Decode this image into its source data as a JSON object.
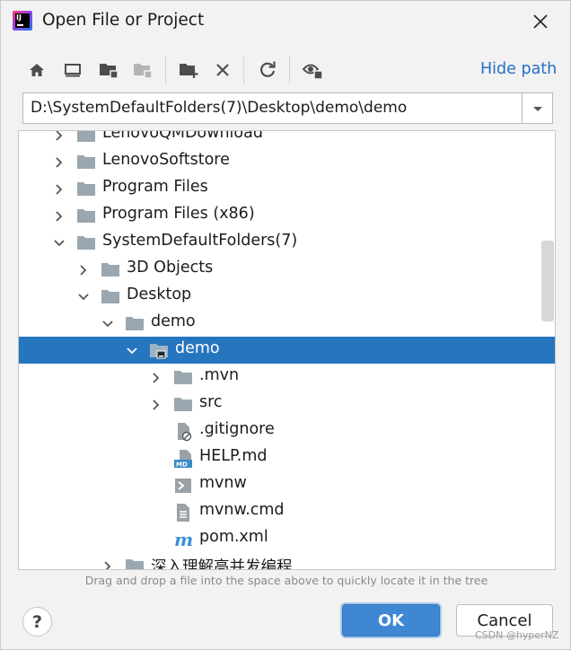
{
  "window": {
    "title": "Open File or Project",
    "app_icon_text": "IJ"
  },
  "toolbar": {
    "buttons": [
      "home-icon",
      "desktop-icon",
      "project-folder-icon",
      "module-folder-icon",
      "new-folder-icon",
      "delete-icon",
      "refresh-icon",
      "show-hidden-icon"
    ],
    "hide_path_label": "Hide path"
  },
  "path": {
    "value": "D:\\SystemDefaultFolders(7)\\Desktop\\demo\\demo"
  },
  "tree": {
    "rows": [
      {
        "label": "LenovoQMDownload",
        "expandable": true,
        "expanded": false,
        "icon": "folder-icon"
      },
      {
        "label": "LenovoSoftstore",
        "expandable": true,
        "expanded": false,
        "icon": "folder-icon"
      },
      {
        "label": "Program Files",
        "expandable": true,
        "expanded": false,
        "icon": "folder-icon"
      },
      {
        "label": "Program Files (x86)",
        "expandable": true,
        "expanded": false,
        "icon": "folder-icon"
      },
      {
        "label": "SystemDefaultFolders(7)",
        "expandable": true,
        "expanded": true,
        "icon": "folder-icon"
      },
      {
        "label": "3D Objects",
        "expandable": true,
        "expanded": false,
        "icon": "folder-icon"
      },
      {
        "label": "Desktop",
        "expandable": true,
        "expanded": true,
        "icon": "folder-icon"
      },
      {
        "label": "demo",
        "expandable": true,
        "expanded": true,
        "icon": "folder-icon"
      },
      {
        "label": "demo",
        "expandable": true,
        "expanded": true,
        "icon": "project-folder-icon",
        "selected": true
      },
      {
        "label": ".mvn",
        "expandable": true,
        "expanded": false,
        "icon": "folder-icon"
      },
      {
        "label": "src",
        "expandable": true,
        "expanded": false,
        "icon": "folder-icon"
      },
      {
        "label": ".gitignore",
        "expandable": false,
        "icon": "ignored-file-icon"
      },
      {
        "label": "HELP.md",
        "expandable": false,
        "icon": "markdown-file-icon",
        "icon_text": "MD"
      },
      {
        "label": "mvnw",
        "expandable": false,
        "icon": "shell-file-icon"
      },
      {
        "label": "mvnw.cmd",
        "expandable": false,
        "icon": "text-file-icon"
      },
      {
        "label": "pom.xml",
        "expandable": false,
        "icon": "maven-file-icon",
        "icon_text": "m"
      },
      {
        "label": "深入理解高并发编程",
        "expandable": true,
        "expanded": false,
        "icon": "folder-icon"
      }
    ]
  },
  "hint": "Drag and drop a file into the space above to quickly locate it in the tree",
  "buttons": {
    "help": "?",
    "ok": "OK",
    "cancel": "Cancel"
  },
  "watermark": "CSDN @hyperNZ",
  "colors": {
    "selection": "#2675bf",
    "link": "#2470c2",
    "ok_button": "#3f87d3",
    "folder": "#9aa7b0"
  }
}
